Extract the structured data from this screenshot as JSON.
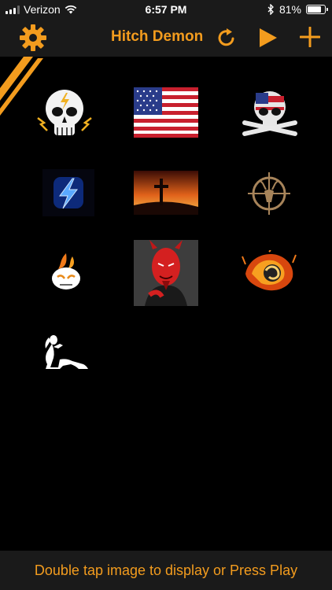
{
  "status_bar": {
    "carrier": "Verizon",
    "time": "6:57 PM",
    "battery": "81%",
    "battery_level": 0.81
  },
  "header": {
    "title": "Hitch Demon",
    "left_icon": "gear-icon",
    "right_icons": [
      "refresh-icon",
      "play-icon",
      "plus-icon"
    ]
  },
  "images": [
    {
      "name": "lightning-skull-image"
    },
    {
      "name": "american-flag-image"
    },
    {
      "name": "flag-skull-crossbones-image"
    },
    {
      "name": "blue-lightning-image"
    },
    {
      "name": "cross-sunset-image"
    },
    {
      "name": "deer-crosshair-image"
    },
    {
      "name": "flaming-skull-image"
    },
    {
      "name": "red-devil-image"
    },
    {
      "name": "flaming-ram-image"
    },
    {
      "name": "mudflap-girl-image"
    }
  ],
  "footer": {
    "hint": "Double tap image to display or Press Play"
  },
  "colors": {
    "accent": "#f39c1e",
    "bar": "#1a1a1a",
    "background": "#000000"
  }
}
